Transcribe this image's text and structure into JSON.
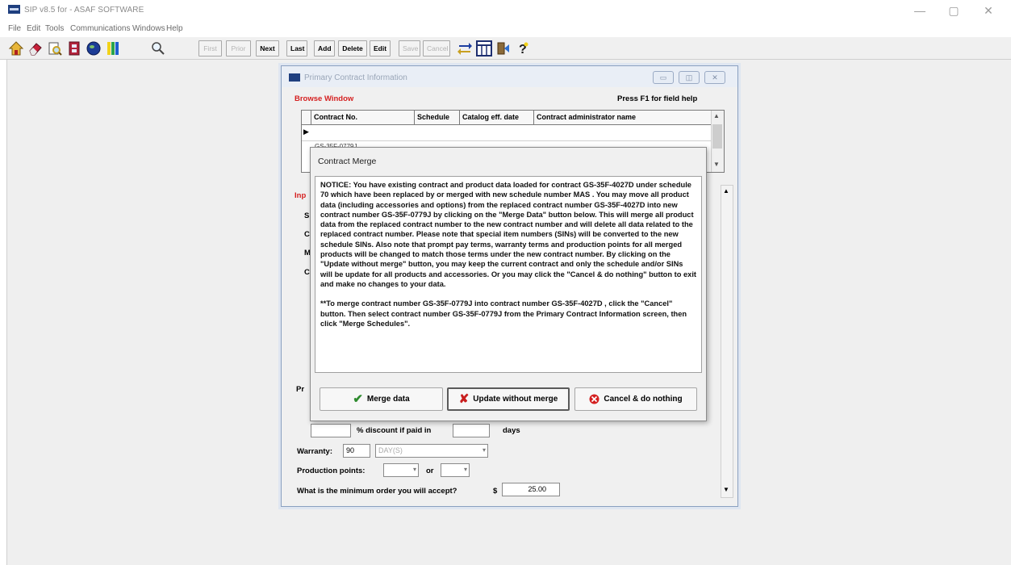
{
  "app": {
    "title": "SIP v8.5 for - ASAF SOFTWARE"
  },
  "window_controls": [
    "—",
    "▢",
    "✕"
  ],
  "menu": [
    "File",
    "Edit",
    "Tools",
    "Communications",
    "Windows",
    "Help"
  ],
  "toolbar": {
    "buttons": [
      {
        "label": "First",
        "enabled": false
      },
      {
        "label": "Prior",
        "enabled": false
      },
      {
        "label": "Next",
        "enabled": true
      },
      {
        "label": "Last",
        "enabled": true
      },
      {
        "label": "Add",
        "enabled": true
      },
      {
        "label": "Delete",
        "enabled": true
      },
      {
        "label": "Edit",
        "enabled": true
      },
      {
        "label": "Save",
        "enabled": false
      },
      {
        "label": "Cancel",
        "enabled": false
      }
    ]
  },
  "pci": {
    "title": "Primary Contract Information",
    "browse_label": "Browse Window",
    "help_text": "Press F1 for field help",
    "columns": [
      "Contract No.",
      "Schedule",
      "Catalog eff. date",
      "Contract administrator name"
    ],
    "row2_value": "GS-35F-0779J",
    "discount_text": "% discount if paid in",
    "days_text": "days",
    "warranty_label": "Warranty:",
    "warranty_value": "90",
    "warranty_unit": "DAY(S)",
    "production_label": "Production points:",
    "or_text": "or",
    "min_order_label": "What is the minimum order you will accept?",
    "currency": "$",
    "min_order_value": "25.00"
  },
  "modal": {
    "title": "Contract Merge",
    "notice": "NOTICE: You have existing contract and product data loaded for contract GS-35F-4027D under schedule 70 which have been replaced by or merged with new schedule number MAS . You may move all product data (including accessories and options) from the replaced contract number GS-35F-4027D into new contract number GS-35F-0779J by clicking on the \"Merge Data\" button below. This will merge all product data from the replaced contract number to the new contract number and will delete all data related to the replaced contract number. Please note that special item numbers (SINs) will be converted to the new schedule SINs. Also note that prompt pay terms, warranty terms and production points for all merged products will be changed to match those terms under the new contract number. By clicking on the \"Update without merge\" button, you may keep the current contract and only the schedule and/or SINs will be update for all products and accessories. Or you may click the \"Cancel & do nothing\" button to exit and make no changes to your data.",
    "note": "**To merge contract number GS-35F-0779J into contract number GS-35F-4027D , click the \"Cancel\" button. Then select contract number GS-35F-0779J from the Primary Contract Information screen, then click \"Merge Schedules\".",
    "buttons": {
      "merge": "Merge data",
      "update": "Update without merge",
      "cancel": "Cancel & do nothing"
    }
  },
  "colors": {
    "red_label": "#d52020",
    "merge_check": "#2e8b2e",
    "update_x": "#c81e1e",
    "cancel_icon": "#d42020"
  }
}
